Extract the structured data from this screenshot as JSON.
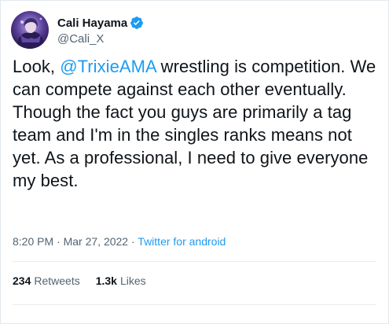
{
  "user": {
    "display_name": "Cali Hayama",
    "handle": "@Cali_X",
    "verified": true,
    "avatar_icon": "user-avatar"
  },
  "tweet": {
    "text_prefix": "Look, ",
    "mention": "@TrixieAMA",
    "text_suffix": " wrestling is competition. We can compete against each other eventually. Though the fact you guys are primarily a tag team and I'm in the singles ranks means not yet. As a professional, I need to give everyone my best."
  },
  "meta": {
    "time": "8:20 PM",
    "separator1": " · ",
    "date": "Mar 27, 2022",
    "separator2": " · ",
    "source": "Twitter for android"
  },
  "stats": {
    "retweets_count": "234",
    "retweets_label": "Retweets",
    "likes_count": "1.3k",
    "likes_label": "Likes"
  },
  "colors": {
    "accent": "#1d9bf0",
    "text": "#0f1419",
    "secondary": "#536471",
    "border": "#e1e8ed"
  }
}
